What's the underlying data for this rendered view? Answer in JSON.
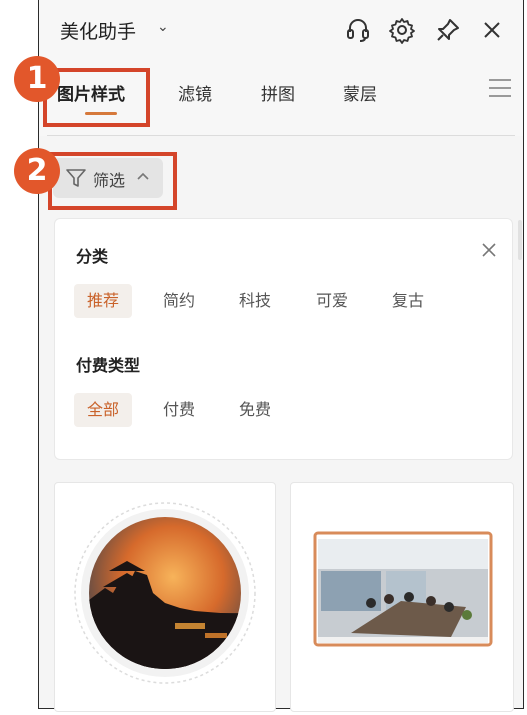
{
  "header": {
    "title": "美化助手",
    "title_caret": "⌄",
    "icons": [
      "headset-icon",
      "gear-icon",
      "pin-icon",
      "close-icon"
    ]
  },
  "tabs": [
    {
      "label": "图片样式",
      "active": true
    },
    {
      "label": "滤镜",
      "active": false
    },
    {
      "label": "拼图",
      "active": false
    },
    {
      "label": "蒙层",
      "active": false
    }
  ],
  "filter_button": {
    "label": "筛选",
    "caret": "^"
  },
  "filter_panel": {
    "category": {
      "title": "分类",
      "options": [
        "推荐",
        "简约",
        "科技",
        "可爱",
        "复古"
      ],
      "selected": "推荐"
    },
    "pay_type": {
      "title": "付费类型",
      "options": [
        "全部",
        "付费",
        "免费"
      ],
      "selected": "全部"
    }
  },
  "annotations": [
    {
      "number": "1",
      "target": "tab-image-style"
    },
    {
      "number": "2",
      "target": "filter-button"
    }
  ],
  "colors": {
    "accent": "#d6793b",
    "selected_text": "#c9622a",
    "marker": "#e2572b",
    "highlight_box": "#d4452a"
  }
}
